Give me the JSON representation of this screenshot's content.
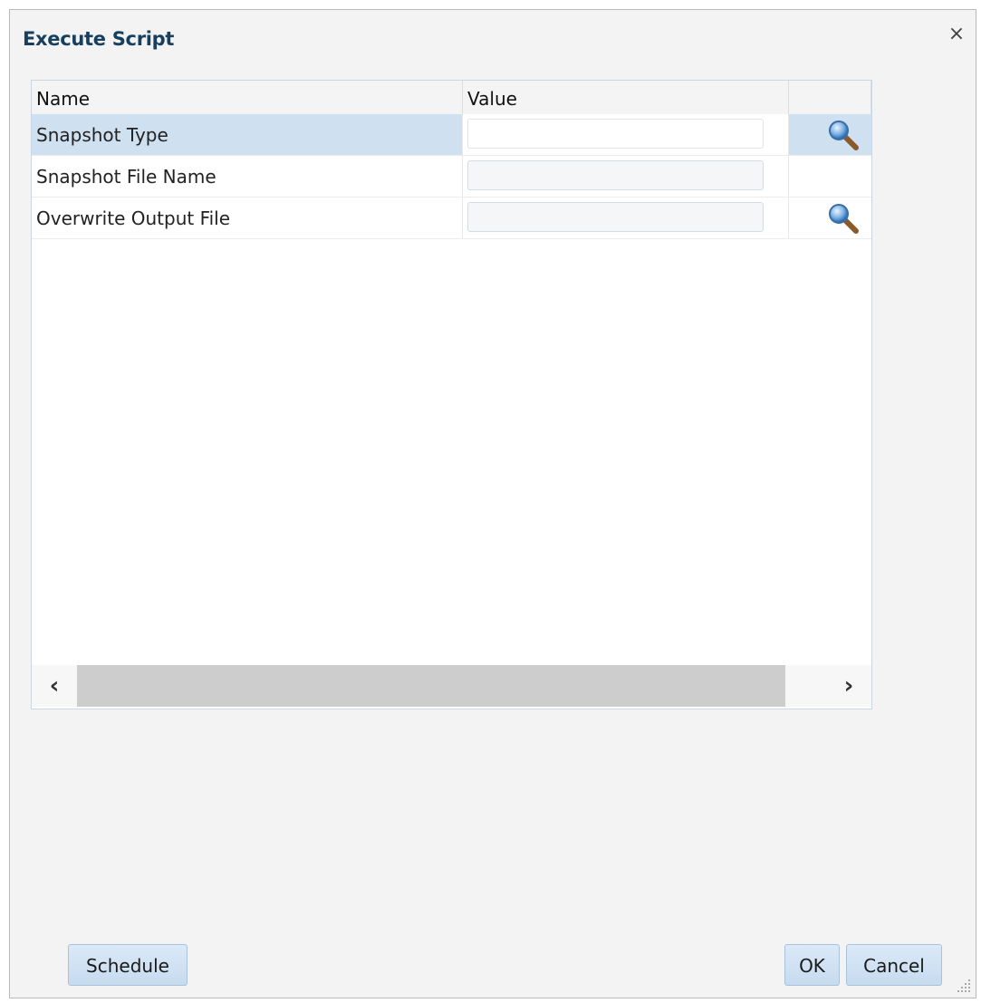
{
  "dialog": {
    "title": "Execute Script",
    "close_glyph": "×"
  },
  "grid": {
    "columns": [
      "Name",
      "Value",
      ""
    ],
    "rows": [
      {
        "name": "Snapshot Type",
        "value": "",
        "has_lookup": true,
        "selected": true
      },
      {
        "name": "Snapshot File Name",
        "value": "",
        "has_lookup": false,
        "selected": false
      },
      {
        "name": "Overwrite Output File",
        "value": "",
        "has_lookup": true,
        "selected": false
      }
    ],
    "scroll_left_glyph": "‹",
    "scroll_right_glyph": "›"
  },
  "buttons": {
    "schedule": "Schedule",
    "ok": "OK",
    "cancel": "Cancel"
  },
  "icons": {
    "lookup": "magnifier-search-icon",
    "close": "close-icon",
    "resize": "resize-grip-icon"
  },
  "colors": {
    "title": "#183f5e",
    "selected_row": "#cfe0f1",
    "button_bg": "#c7dbef",
    "dialog_bg": "#f3f3f3"
  }
}
